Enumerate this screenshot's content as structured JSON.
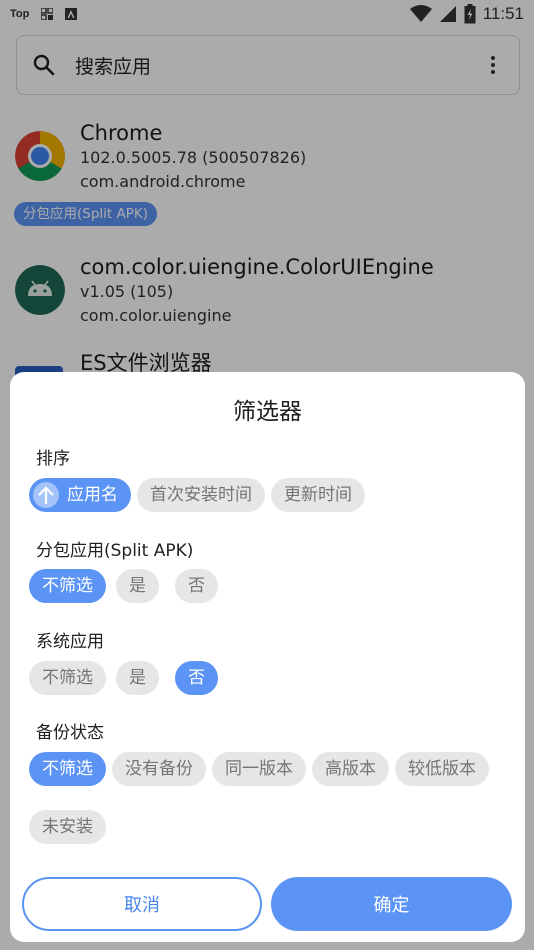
{
  "status_bar": {
    "left_labels": [
      "Top"
    ],
    "time": "11:51"
  },
  "search": {
    "placeholder": "搜索应用"
  },
  "apps": [
    {
      "name": "Chrome",
      "version": "102.0.5005.78 (500507826)",
      "package": "com.android.chrome",
      "badge": "分包应用(Split APK)"
    },
    {
      "name": "com.color.uiengine.ColorUIEngine",
      "version": "v1.05 (105)",
      "package": "com.color.uiengine"
    },
    {
      "name": "ES文件浏览器"
    }
  ],
  "dialog": {
    "title": "筛选器",
    "sections": {
      "sort": {
        "label": "排序",
        "options": [
          "应用名",
          "首次安装时间",
          "更新时间"
        ],
        "selected": "应用名",
        "direction_icon": "arrow-up-icon"
      },
      "split_apk": {
        "label": "分包应用(Split APK)",
        "options": [
          "不筛选",
          "是",
          "否"
        ],
        "selected": "不筛选"
      },
      "system_app": {
        "label": "系统应用",
        "options": [
          "不筛选",
          "是",
          "否"
        ],
        "selected": "否"
      },
      "backup": {
        "label": "备份状态",
        "options": [
          "不筛选",
          "没有备份",
          "同一版本",
          "高版本",
          "较低版本",
          "未安装"
        ],
        "selected": "不筛选"
      }
    },
    "cancel_label": "取消",
    "ok_label": "确定"
  },
  "colors": {
    "accent": "#5b94f5",
    "chip_bg": "#e6e6e6",
    "scrim": "rgba(0,0,0,0.33)"
  }
}
